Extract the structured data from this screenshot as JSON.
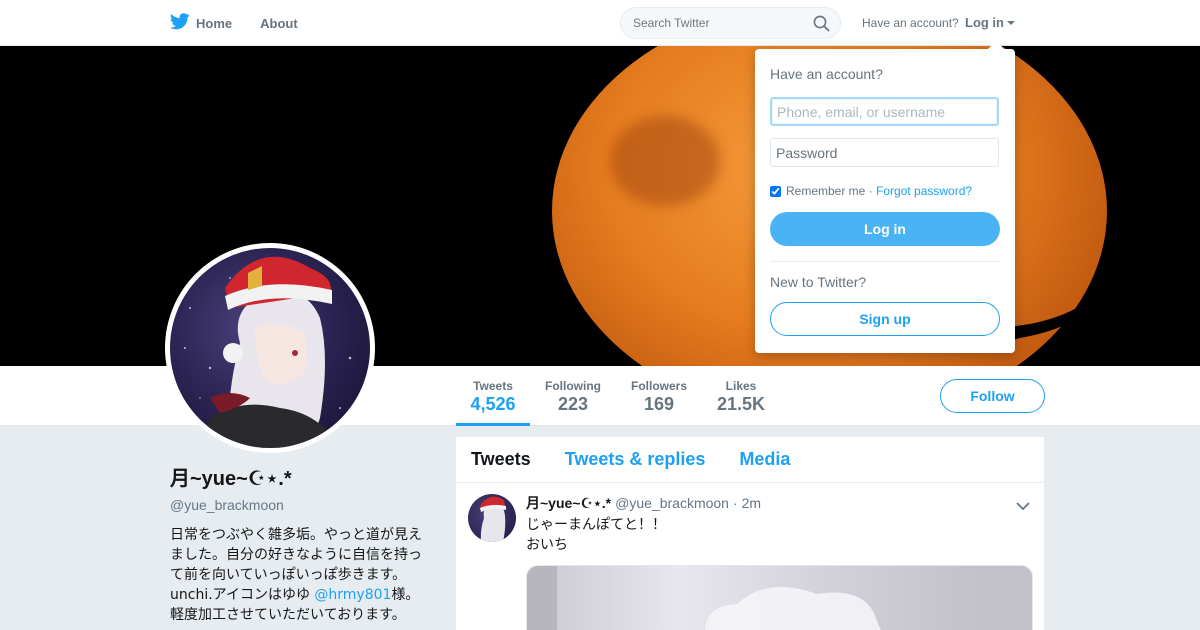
{
  "nav": {
    "home_label": "Home",
    "about_label": "About",
    "search_placeholder": "Search Twitter",
    "account_question": "Have an account?",
    "login_label": "Log in"
  },
  "profile": {
    "display_name": "月~yue~☪⋆.*",
    "handle": "@yue_brackmoon",
    "bio_before_mention": "日常をつぶやく雑多垢。やっと道が見えました。自分の好きなように自信を持って前を向いていっぽいっぽ歩きます。unchi.アイコンはゆゆ ",
    "bio_mention": "@hrmy801",
    "bio_after_mention": "様。軽度加工させていただいております。",
    "follow_label": "Follow"
  },
  "stats": [
    {
      "label": "Tweets",
      "value": "4,526"
    },
    {
      "label": "Following",
      "value": "223"
    },
    {
      "label": "Followers",
      "value": "169"
    },
    {
      "label": "Likes",
      "value": "21.5K"
    }
  ],
  "timeline": {
    "tabs": [
      "Tweets",
      "Tweets & replies",
      "Media"
    ],
    "tweet": {
      "name": "月~yue~☪⋆.*",
      "handle": "@yue_brackmoon",
      "dot": "·",
      "time": "2m",
      "line1": "じゃーまんぽてと！！",
      "line2": "おいち"
    }
  },
  "login_dropdown": {
    "title": "Have an account?",
    "username_placeholder": "Phone, email, or username",
    "password_placeholder": "Password",
    "remember_label": "Remember me",
    "separator": " · ",
    "forgot_label": "Forgot password?",
    "login_button": "Log in",
    "new_prompt": "New to Twitter?",
    "signup_button": "Sign up"
  },
  "colors": {
    "brand": "#1da1f2",
    "background": "#e6ecf0",
    "muted_text": "#66757f"
  }
}
